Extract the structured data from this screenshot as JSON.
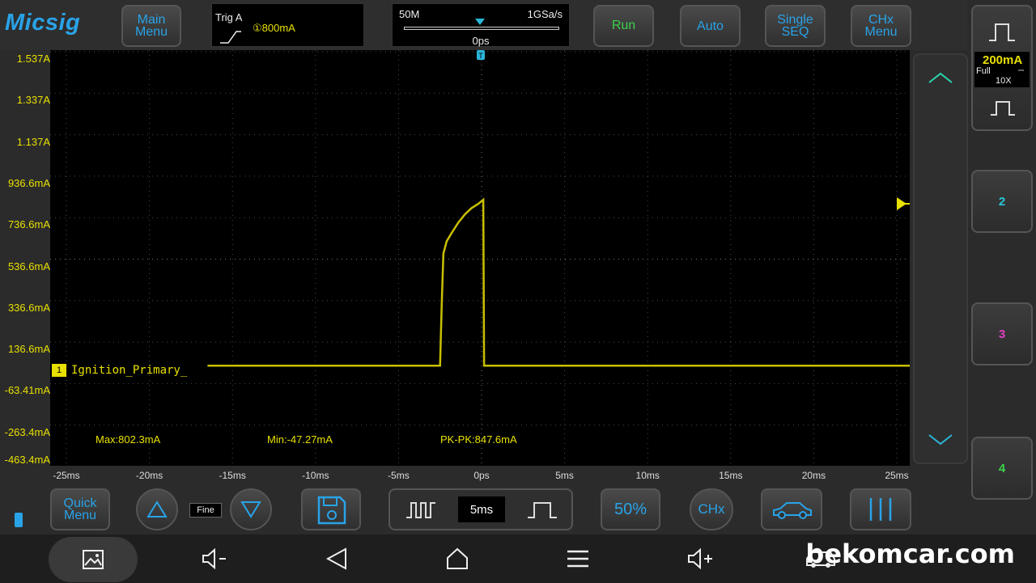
{
  "brand": "Micsig",
  "top_buttons": {
    "main_menu": "Main\nMenu",
    "run": "Run",
    "auto": "Auto",
    "single_seq": "Single\nSEQ",
    "chx_menu": "CHx\nMenu"
  },
  "trigger": {
    "label": "Trig A",
    "level": "①800mA"
  },
  "timebase": {
    "memory": "50M",
    "rate": "1GSa/s",
    "offset": "0ps"
  },
  "y_axis_labels": [
    "1.537A",
    "1.337A",
    "1.137A",
    "936.6mA",
    "736.6mA",
    "536.6mA",
    "336.6mA",
    "136.6mA",
    "-63.41mA",
    "-263.4mA",
    "-463.4mA"
  ],
  "x_axis_labels": [
    "-25ms",
    "-20ms",
    "-15ms",
    "-10ms",
    "-5ms",
    "0ps",
    "5ms",
    "10ms",
    "15ms",
    "20ms",
    "25ms"
  ],
  "channel": {
    "number": "1",
    "name": "Ignition_Primary_",
    "color": "#c8c000",
    "scale": "200mA",
    "bandwidth": "Full",
    "probe": "10X"
  },
  "measurements": {
    "max": "Max:802.3mA",
    "min": "Min:-47.27mA",
    "pkpk": "PK-PK:847.6mA"
  },
  "channels_side": [
    {
      "label": "2",
      "color": "#29c8d8"
    },
    {
      "label": "3",
      "color": "#e040c0"
    },
    {
      "label": "4",
      "color": "#3cd24a"
    }
  ],
  "bottom_controls": {
    "quick_menu": "Quick\nMenu",
    "fine": "Fine",
    "timebase": "5ms",
    "fifty": "50%",
    "chx": "CHx"
  },
  "watermark": "bekomcar.com",
  "chart_data": {
    "type": "line",
    "x_unit": "ms",
    "y_unit": "mA",
    "xlim": [
      -25,
      25
    ],
    "ylim": [
      -463.4,
      1537
    ],
    "grid": true,
    "series": [
      {
        "name": "Ignition_Primary_",
        "x": [
          -16.5,
          -2.5,
          -2.4,
          -2.3,
          -2.1,
          -1.8,
          -1.4,
          -1.0,
          -0.6,
          -0.2,
          0.1,
          0.15,
          0.2,
          25
        ],
        "y": [
          0,
          0,
          300,
          540,
          600,
          640,
          690,
          730,
          760,
          780,
          800,
          0,
          0,
          0
        ]
      }
    ]
  }
}
